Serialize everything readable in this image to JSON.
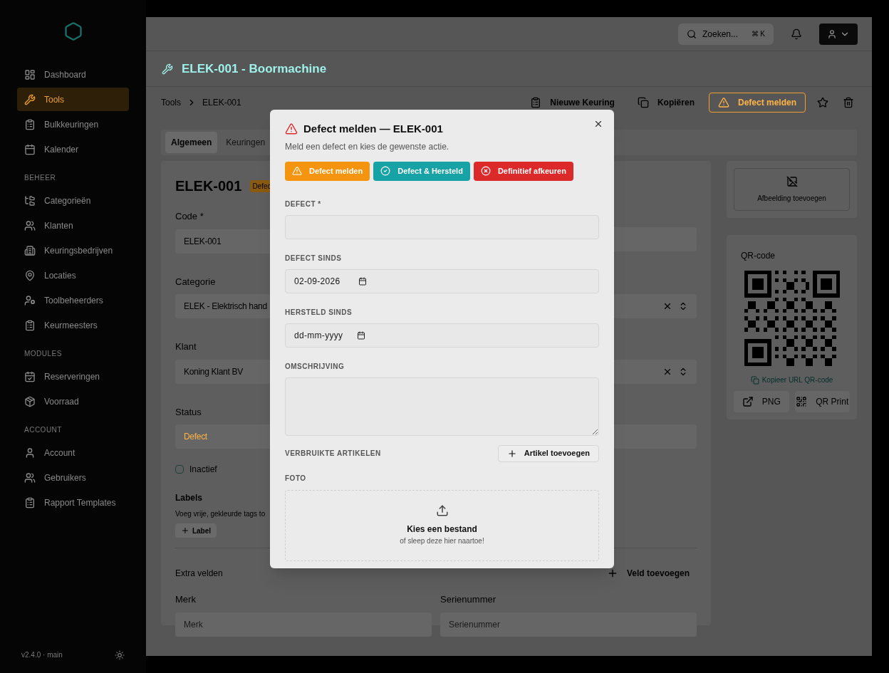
{
  "sidebar": {
    "groups": [
      {
        "items": [
          {
            "label": "Dashboard",
            "selected": false
          },
          {
            "label": "Tools",
            "selected": true
          },
          {
            "label": "Bulkkeuringen",
            "selected": false
          },
          {
            "label": "Kalender",
            "selected": false
          }
        ]
      },
      {
        "heading": "BEHEER",
        "items": [
          {
            "label": "Categorieën",
            "selected": false
          },
          {
            "label": "Klanten",
            "selected": false
          },
          {
            "label": "Keuringsbedrijven",
            "selected": false
          },
          {
            "label": "Locaties",
            "selected": false
          },
          {
            "label": "Toolbeheerders",
            "selected": false
          },
          {
            "label": "Keurmeesters",
            "selected": false
          }
        ]
      },
      {
        "heading": "MODULES",
        "items": [
          {
            "label": "Reserveringen",
            "selected": false
          },
          {
            "label": "Voorraad",
            "selected": false
          }
        ]
      },
      {
        "heading": "ACCOUNT",
        "items": [
          {
            "label": "Account",
            "selected": false
          },
          {
            "label": "Gebruikers",
            "selected": false
          },
          {
            "label": "Rapport Templates",
            "selected": false
          }
        ]
      }
    ],
    "version": "v2.4.0 · main"
  },
  "topbar": {
    "search": {
      "placeholder": "Zoeken...",
      "shortcut": "⌘ K"
    }
  },
  "page_title": "ELEK-001 - Boormachine",
  "breadcrumb": [
    "Tools",
    "ELEK-001"
  ],
  "actions": [
    {
      "label": "Nieuwe Keuring",
      "kind": "plain"
    },
    {
      "label": "Kopiëren",
      "kind": "plain"
    },
    {
      "label": "Defect melden",
      "kind": "warning"
    }
  ],
  "tabs": [
    {
      "label": "Algemeen",
      "selected": true
    },
    {
      "label": "Keuringen",
      "selected": false
    }
  ],
  "form": {
    "title": "ELEK-001",
    "badge": "Defec",
    "code": {
      "label": "Code *",
      "value": "ELEK-001"
    },
    "categorie": {
      "label": "Categorie",
      "value": "ELEK - Elektrisch hand"
    },
    "klant": {
      "label": "Klant",
      "value": "Koning Klant BV"
    },
    "status": {
      "label": "Status",
      "value": "Defect"
    },
    "inactief": {
      "label": "Inactief",
      "checked": false
    },
    "labels": {
      "title": "Labels",
      "hint": "Voeg vrije, gekleurde tags to",
      "button": "Label"
    },
    "extra": {
      "title": "Extra velden",
      "button": "Veld toevoegen"
    },
    "merk": {
      "label": "Merk",
      "placeholder": "Merk"
    },
    "serienummer": {
      "label": "Serienummer",
      "placeholder": "Serienummer"
    }
  },
  "image": {
    "label": "Afbeelding toevoegen"
  },
  "qr": {
    "title": "QR-code",
    "link": "Kopieer URL QR-code",
    "buttons": [
      "PNG",
      "QR Print"
    ]
  },
  "modal": {
    "title": "Defect melden — ELEK-001",
    "subtitle": "Meld een defect en kies de gewenste actie.",
    "buttons": [
      {
        "label": "Defect melden",
        "kind": "warning"
      },
      {
        "label": "Defect & Hersteld",
        "kind": "success"
      },
      {
        "label": "Definitief afkeuren",
        "kind": "danger"
      }
    ],
    "defect": {
      "label": "DEFECT *"
    },
    "defect_sinds": {
      "label": "DEFECT SINDS",
      "value": "02-09-2026"
    },
    "hersteld_sinds": {
      "label": "HERSTELD SINDS",
      "placeholder": "dd-mm-yyyy"
    },
    "omschrijving": {
      "label": "OMSCHRIJVING"
    },
    "artikelen": {
      "label": "VERBRUIKTE ARTIKELEN",
      "button": "Artikel toevoegen"
    },
    "foto": {
      "label": "FOTO",
      "title": "Kies een bestand",
      "hint": "of sleep deze hier naartoe!"
    }
  }
}
